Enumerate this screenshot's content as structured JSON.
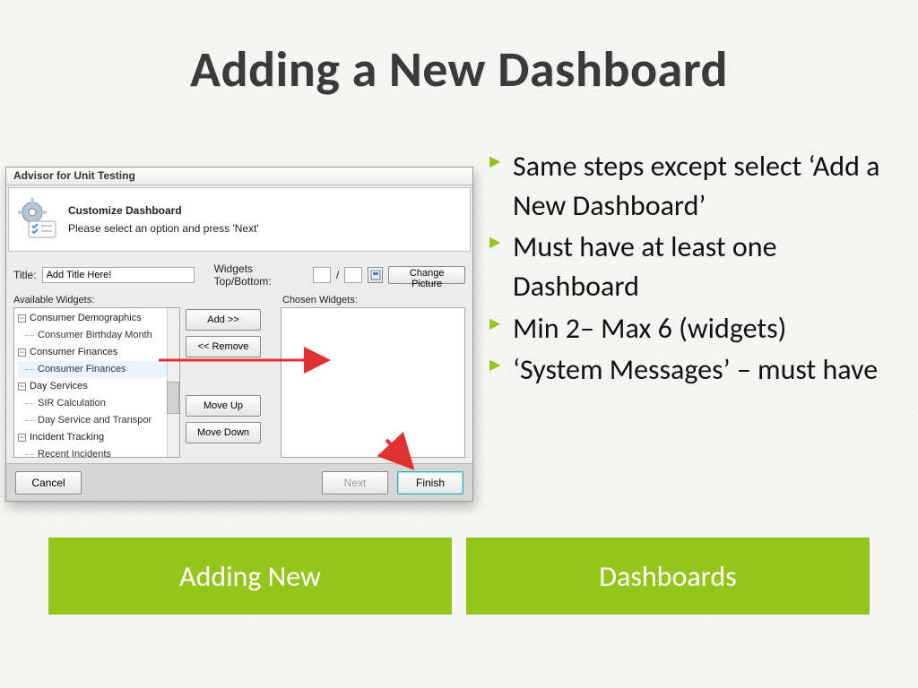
{
  "slide": {
    "title": "Adding a New Dashboard"
  },
  "bullets": {
    "items": [
      "Same steps except select ‘Add a New Dashboard’",
      "Must have at least one Dashboard",
      "Min 2– Max 6 (widgets)",
      "‘System Messages’ – must have"
    ]
  },
  "banners": {
    "left": "Adding New",
    "right": "Dashboards"
  },
  "dialog": {
    "window_title": "Advisor for Unit Testing",
    "header_title": "Customize Dashboard",
    "header_subtitle": "Please select an option and press 'Next'",
    "title_label": "Title:",
    "title_value": "Add Title Here!",
    "widgets_tb_label": "Widgets Top/Bottom:",
    "slash": "/",
    "change_picture_btn": "Change Picture",
    "available_label": "Available Widgets:",
    "chosen_label": "Chosen Widgets:",
    "tree": [
      {
        "kind": "group",
        "label": "Consumer Demographics",
        "open": true
      },
      {
        "kind": "leaf",
        "label": "Consumer Birthday Month"
      },
      {
        "kind": "group",
        "label": "Consumer Finances",
        "open": true
      },
      {
        "kind": "leaf",
        "label": "Consumer Finances",
        "highlight": true
      },
      {
        "kind": "group",
        "label": "Day Services",
        "open": true
      },
      {
        "kind": "leaf",
        "label": "SIR Calculation"
      },
      {
        "kind": "leaf",
        "label": "Day Service and Transpor"
      },
      {
        "kind": "group",
        "label": "Incident Tracking",
        "open": true
      },
      {
        "kind": "leaf",
        "label": "Recent Incidents"
      }
    ],
    "btns": {
      "add": "Add >>",
      "remove": "<< Remove",
      "move_up": "Move Up",
      "move_down": "Move Down"
    },
    "footer": {
      "cancel": "Cancel",
      "next": "Next",
      "finish": "Finish"
    }
  }
}
